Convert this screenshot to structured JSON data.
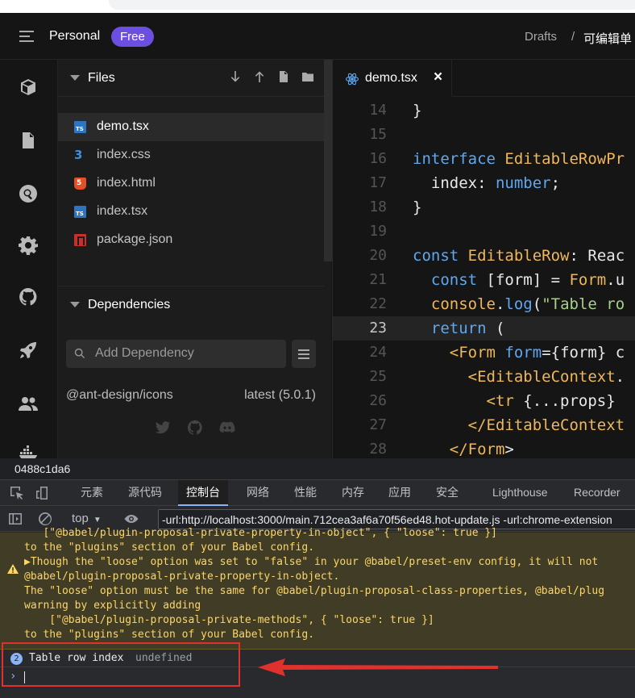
{
  "topbar": {
    "workspace": "Personal",
    "plan_badge": "Free",
    "breadcrumb_root": "Drafts",
    "breadcrumb_sep": "/",
    "breadcrumb_current": "可编辑单"
  },
  "activity_icons": [
    "cube-icon",
    "file-icon",
    "search-icon",
    "gear-icon",
    "github-icon",
    "rocket-icon",
    "users-icon",
    "docker-icon"
  ],
  "files_panel": {
    "title": "Files",
    "items": [
      {
        "name": "demo.tsx",
        "type": "ts",
        "badge": "TS",
        "active": true
      },
      {
        "name": "index.css",
        "type": "css",
        "badge": "3",
        "active": false
      },
      {
        "name": "index.html",
        "type": "html",
        "badge": "5",
        "active": false
      },
      {
        "name": "index.tsx",
        "type": "ts",
        "badge": "TS",
        "active": false
      },
      {
        "name": "package.json",
        "type": "json",
        "badge": "",
        "active": false
      }
    ]
  },
  "dependencies": {
    "title": "Dependencies",
    "search_placeholder": "Add Dependency",
    "items": [
      {
        "name": "@ant-design/icons",
        "version": "latest (5.0.1)"
      }
    ]
  },
  "editor": {
    "tab_name": "demo.tsx",
    "tab_close": "×",
    "current_line": 23,
    "lines": [
      {
        "n": "14",
        "code": "}"
      },
      {
        "n": "15",
        "code": ""
      },
      {
        "n": "16",
        "code": "interface EditableRowPr"
      },
      {
        "n": "17",
        "code": "  index: number;"
      },
      {
        "n": "18",
        "code": "}"
      },
      {
        "n": "19",
        "code": ""
      },
      {
        "n": "20",
        "code": "const EditableRow: Reac"
      },
      {
        "n": "21",
        "code": "  const [form] = Form.u"
      },
      {
        "n": "22",
        "code": "  console.log(\"Table ro"
      },
      {
        "n": "23",
        "code": "  return ("
      },
      {
        "n": "24",
        "code": "    <Form form={form} c"
      },
      {
        "n": "25",
        "code": "      <EditableContext."
      },
      {
        "n": "26",
        "code": "        <tr {...props}"
      },
      {
        "n": "27",
        "code": "      </EditableContext"
      },
      {
        "n": "28",
        "code": "    </Form>"
      }
    ]
  },
  "devtools": {
    "frame_id": "0488c1da6",
    "tabs": [
      "元素",
      "源代码",
      "控制台",
      "网络",
      "性能",
      "内存",
      "应用",
      "安全",
      "Lighthouse",
      "Recorder"
    ],
    "active_tab": "控制台",
    "context": "top",
    "filter_value": "-url:http://localhost:3000/main.712cea3af6a70f56ed48.hot-update.js -url:chrome-extension",
    "warning_lines": [
      "   [\"@babel/plugin-proposal-private-property-in-object\", { \"loose\": true }]",
      "to the \"plugins\" section of your Babel config.",
      "▶Though the \"loose\" option was set to \"false\" in your @babel/preset-env config, it will not",
      "@babel/plugin-proposal-private-property-in-object.",
      "The \"loose\" option must be the same for @babel/plugin-proposal-class-properties, @babel/plug",
      "warning by explicitly adding",
      "    [\"@babel/plugin-proposal-private-methods\", { \"loose\": true }]",
      "to the \"plugins\" section of your Babel config."
    ],
    "log": {
      "count": "2",
      "text": "Table row index",
      "value": "undefined"
    },
    "prompt": "›"
  },
  "colors": {
    "badge": "#6c4fe0",
    "keyword": "#5ea8f2",
    "tag": "#f0b75a",
    "warning_bg": "#413c26",
    "warning_text": "#fdd663",
    "annotation_red": "#e0312d"
  }
}
